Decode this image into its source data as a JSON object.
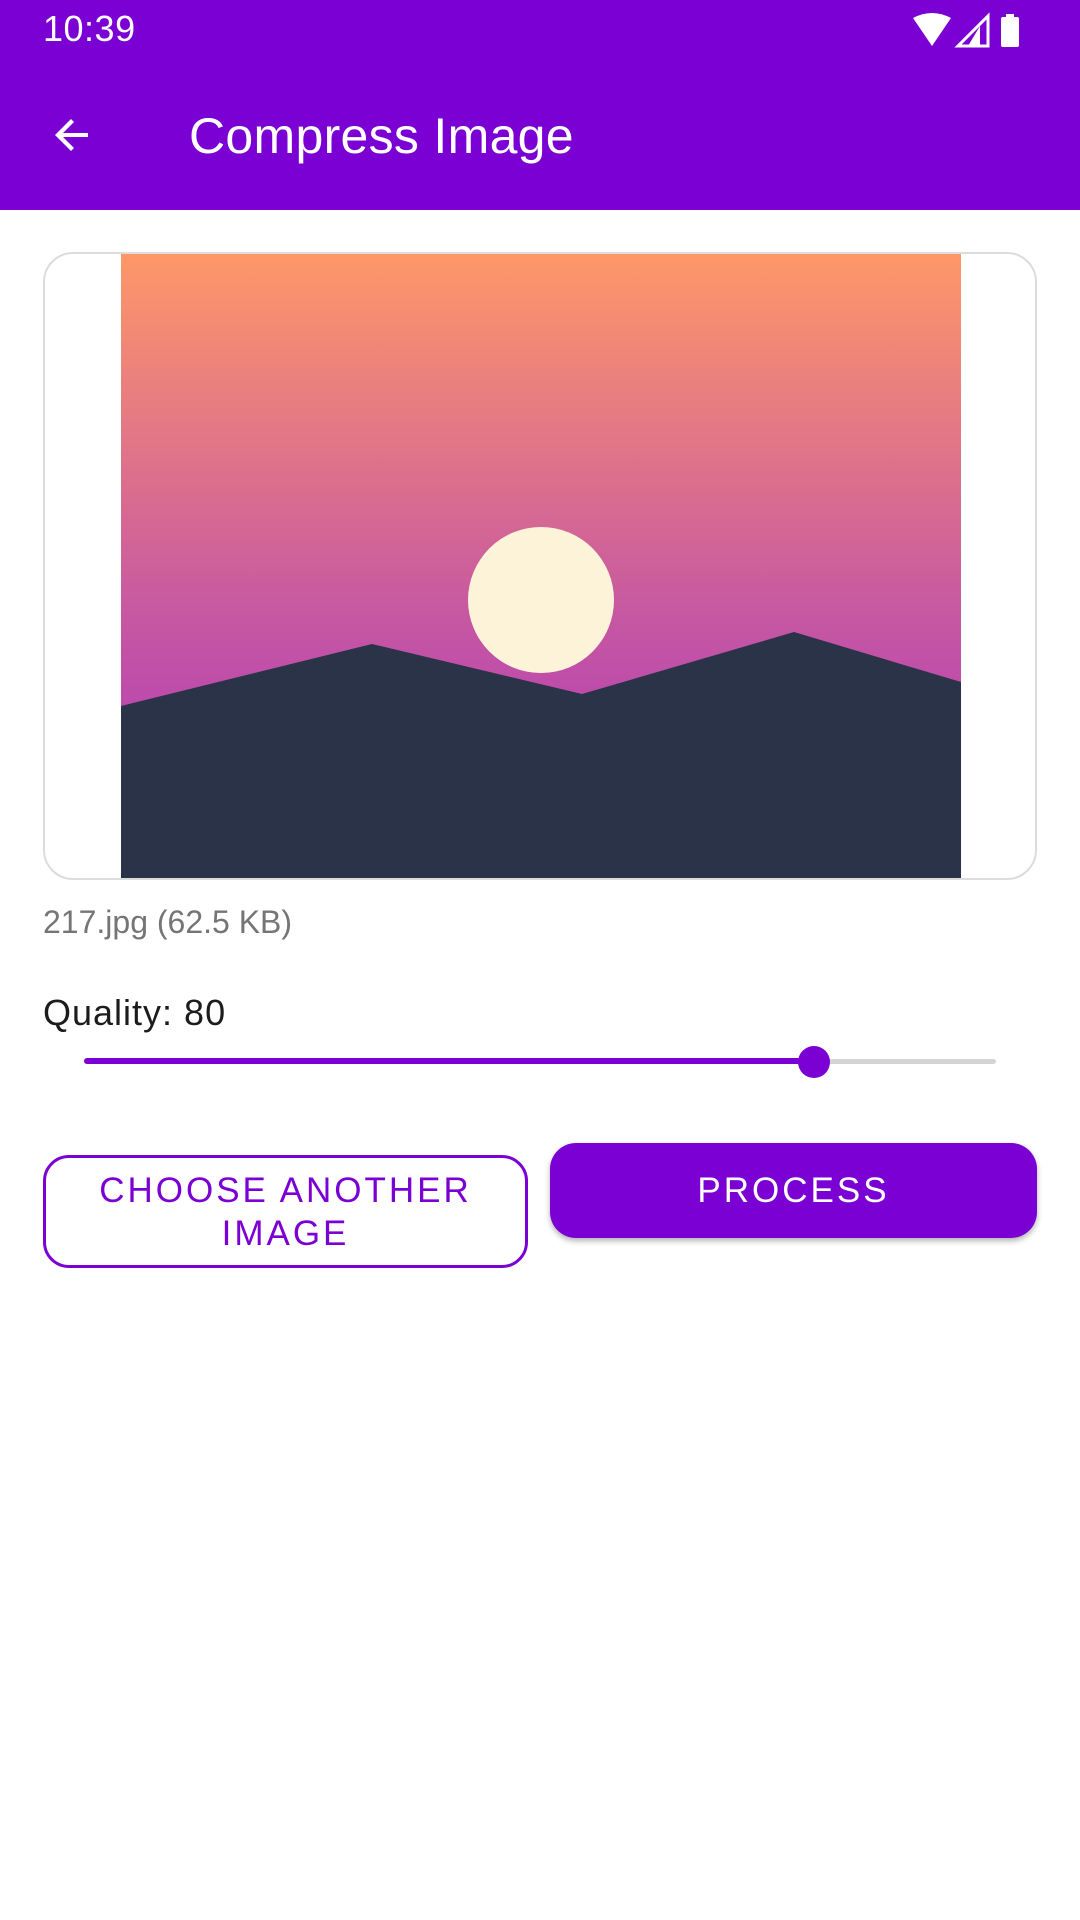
{
  "status_bar": {
    "time": "10:39",
    "icons": [
      "wifi-icon",
      "signal-icon",
      "battery-icon"
    ]
  },
  "app_bar": {
    "back_icon": "arrow-back-icon",
    "title": "Compress Image"
  },
  "preview": {
    "image_description_icon": "landscape-placeholder-image"
  },
  "file_info": "217.jpg (62.5 KB)",
  "quality": {
    "label": "Quality: 80",
    "value": 80,
    "min": 0,
    "max": 100
  },
  "buttons": {
    "choose_another": "CHOOSE ANOTHER IMAGE",
    "process": "PROCESS"
  },
  "colors": {
    "primary": "#7b00d4",
    "track_inactive": "#d4d4d4",
    "sky_top": "#ff9768",
    "sky_bottom": "#a931c0",
    "sun": "#fdf3d9",
    "mountains": "#2a3347"
  }
}
